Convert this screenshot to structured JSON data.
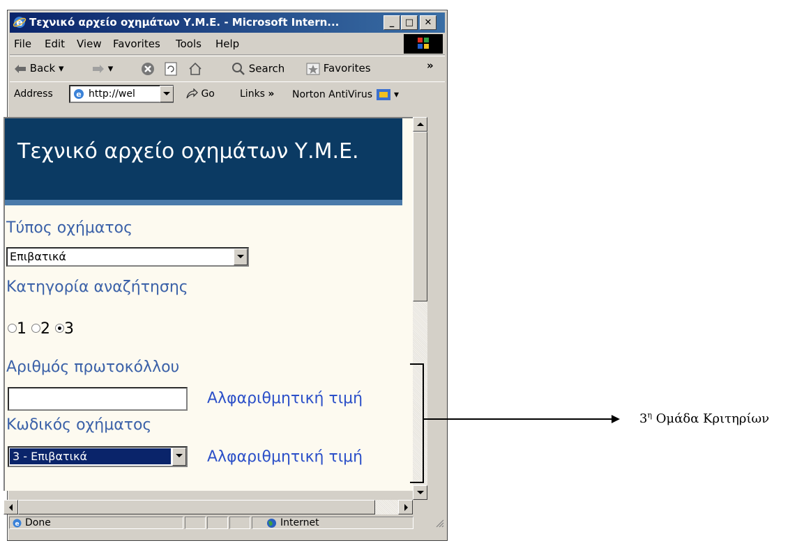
{
  "window": {
    "title": "Τεχνικό αρχείο οχημάτων Υ.Μ.Ε. - Microsoft Intern...",
    "minimize": "_",
    "maximize": "□",
    "close": "✕"
  },
  "menu": {
    "file": "File",
    "edit": "Edit",
    "view": "View",
    "favorites": "Favorites",
    "tools": "Tools",
    "help": "Help"
  },
  "toolbar": {
    "back": "Back",
    "search": "Search",
    "favorites": "Favorites",
    "more": "»"
  },
  "address": {
    "label": "Address",
    "value": "http://wel",
    "go": "Go",
    "links": "Links",
    "links_more": "»",
    "norton": "Norton AntiVirus"
  },
  "page": {
    "banner_title": "Τεχνικό αρχείο οχημάτων Υ.Μ.Ε.",
    "vehicle_type_label": "Τύπος οχήματος",
    "vehicle_type_value": "Επιβατικά",
    "search_category_label": "Κατηγορία αναζήτησης",
    "radio_options": [
      "1",
      "2",
      "3"
    ],
    "radio_selected": "3",
    "protocol_label": "Αριθμός πρωτοκόλλου",
    "protocol_value": "",
    "protocol_hint": "Αλφαριθμητική τιμή",
    "vehicle_code_label": "Κωδικός οχήματος",
    "vehicle_code_value": "3 - Επιβατικά",
    "vehicle_code_hint": "Αλφαριθμητική τιμή"
  },
  "status": {
    "text": "Done",
    "zone": "Internet"
  },
  "annotation": {
    "label_prefix": "3",
    "label_sup": "η",
    "label_suffix": " Ομάδα Κριτηρίων"
  }
}
